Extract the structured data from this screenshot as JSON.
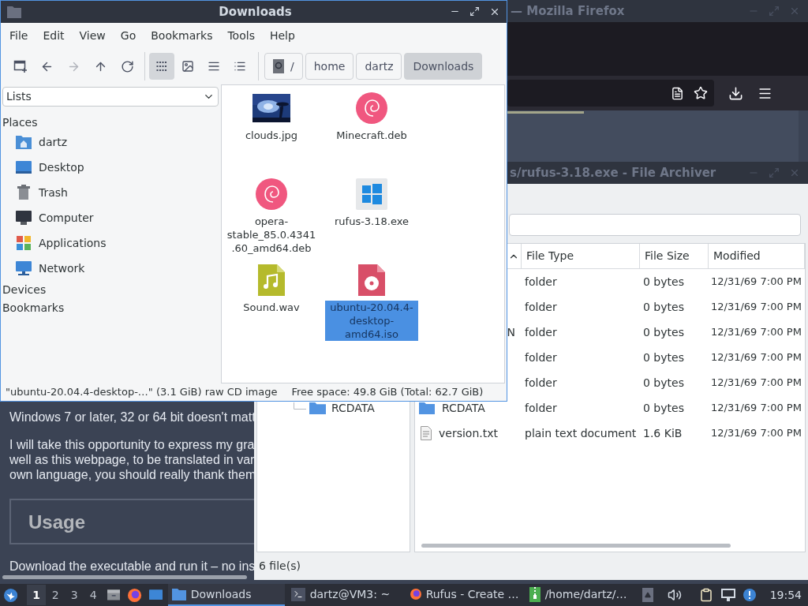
{
  "firefox": {
    "title": "— Mozilla Firefox",
    "page": {
      "paragraphs": [
        "Windows 7 or later, 32 or 64 bit doesn't matt",
        "I will take this opportunity to express my gra\nwell as this webpage, to be translated in var\nown language, you should really thank them"
      ],
      "heading": "Usage",
      "trailing_text": "Download the executable and run it – no ins"
    }
  },
  "archiver": {
    "title": "s/rufus-3.18.exe - File Archiver",
    "columns": [
      "File Type",
      "File Size",
      "Modified"
    ],
    "tree": [
      "RCDATA"
    ],
    "rows": [
      {
        "type": "folder",
        "size": "0 bytes",
        "modified": "12/31/69 7:00 PM"
      },
      {
        "type": "folder",
        "size": "0 bytes",
        "modified": "12/31/69 7:00 PM"
      },
      {
        "name": "N",
        "type": "folder",
        "size": "0 bytes",
        "modified": "12/31/69 7:00 PM"
      },
      {
        "type": "folder",
        "size": "0 bytes",
        "modified": "12/31/69 7:00 PM"
      },
      {
        "type": "folder",
        "size": "0 bytes",
        "modified": "12/31/69 7:00 PM"
      },
      {
        "name": "RCDATA",
        "kind": "folder",
        "type": "folder",
        "size": "0 bytes",
        "modified": "12/31/69 7:00 PM"
      },
      {
        "name": "version.txt",
        "kind": "text",
        "type": "plain text document",
        "size": "1.6 KiB",
        "modified": "12/31/69 7:00 PM"
      }
    ],
    "status": "6 file(s)"
  },
  "file_manager": {
    "title": "Downloads",
    "menu": [
      "File",
      "Edit",
      "View",
      "Go",
      "Bookmarks",
      "Tools",
      "Help"
    ],
    "actions": [
      {
        "disabled": false
      },
      {
        "disabled": false
      },
      {
        "disabled": true
      },
      {
        "disabled": false
      },
      {
        "disabled": false
      }
    ],
    "view_modes": [
      {
        "selected": true
      },
      {
        "selected": false
      },
      {
        "selected": false
      },
      {
        "selected": false
      }
    ],
    "path": [
      {
        "label": "/",
        "selected": false
      },
      {
        "label": "home",
        "selected": false
      },
      {
        "label": "dartz",
        "selected": false
      },
      {
        "label": "Downloads",
        "selected": true
      }
    ],
    "side_pane": {
      "dropdown": "Lists",
      "places_header": "Places",
      "places": [
        "dartz",
        "Desktop",
        "Trash",
        "Computer",
        "Applications",
        "Network"
      ],
      "devices_header": "Devices",
      "bookmarks_header": "Bookmarks"
    },
    "files": [
      {
        "name": "clouds.jpg",
        "selected": false
      },
      {
        "name": "Minecraft.deb",
        "kind": "deb",
        "selected": false
      },
      {
        "name": "opera-stable_85.0.4341.60_amd64.deb",
        "kind": "deb",
        "selected": false
      },
      {
        "name": "rufus-3.18.exe",
        "kind": "exe",
        "selected": false
      },
      {
        "name": "Sound.wav",
        "kind": "audio",
        "selected": false
      },
      {
        "name": "ubuntu-20.04.4-desktop-amd64.iso",
        "kind": "iso",
        "selected": true
      }
    ],
    "status": {
      "selection": "\"ubuntu-20.04.4-desktop-…\" (3.1 GiB) raw CD image",
      "free_space": "Free space: 49.8 GiB (Total: 62.7 GiB)"
    }
  },
  "taskbar": {
    "workspaces": [
      {
        "label": "1",
        "selected": true
      },
      {
        "label": "2",
        "selected": false
      },
      {
        "label": "3",
        "selected": false
      },
      {
        "label": "4",
        "selected": false
      }
    ],
    "tasks": [
      {
        "label": "Downloads",
        "selected": true
      },
      {
        "label": "dartz@VM3: ~",
        "selected": false
      },
      {
        "label": "Rufus - Create …",
        "selected": false
      },
      {
        "label": "/home/dartz/…",
        "selected": false
      }
    ],
    "clock": "19:54"
  }
}
